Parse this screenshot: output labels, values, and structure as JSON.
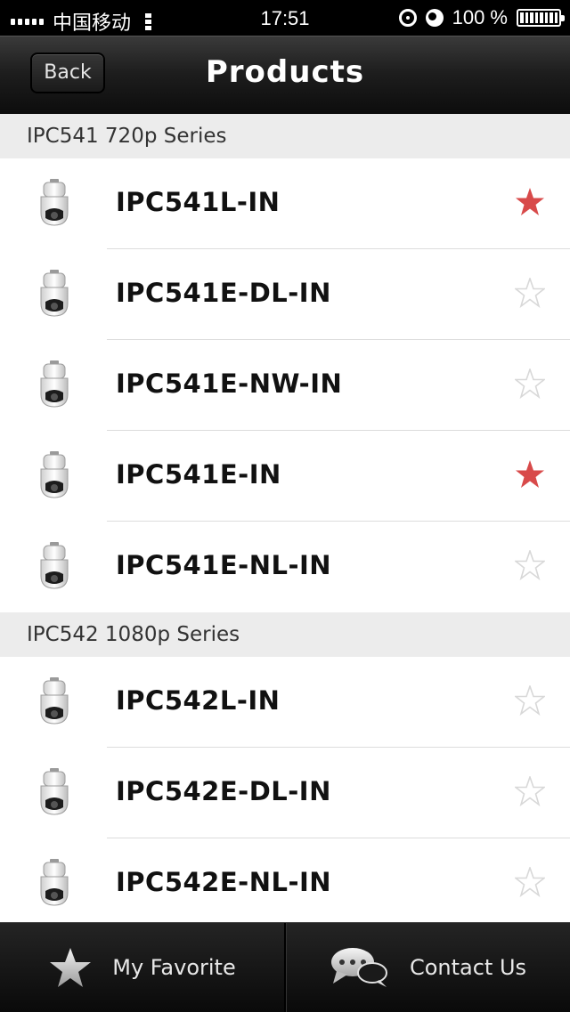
{
  "status_bar": {
    "carrier": "中国移动",
    "time": "17:51",
    "battery": "100 %"
  },
  "nav": {
    "back_label": "Back",
    "title": "Products"
  },
  "sections": [
    {
      "header": "IPC541 720p Series",
      "items": [
        {
          "label": "IPC541L-IN",
          "favorite": true
        },
        {
          "label": "IPC541E-DL-IN",
          "favorite": false
        },
        {
          "label": "IPC541E-NW-IN",
          "favorite": false
        },
        {
          "label": "IPC541E-IN",
          "favorite": true
        },
        {
          "label": "IPC541E-NL-IN",
          "favorite": false
        }
      ]
    },
    {
      "header": "IPC542 1080p Series",
      "items": [
        {
          "label": "IPC542L-IN",
          "favorite": false
        },
        {
          "label": "IPC542E-DL-IN",
          "favorite": false
        },
        {
          "label": "IPC542E-NL-IN",
          "favorite": false
        }
      ]
    }
  ],
  "tabbar": {
    "favorite_label": "My Favorite",
    "contact_label": "Contact Us"
  },
  "icons": {
    "product": "camera-icon",
    "favorite_on": "star-filled-icon",
    "favorite_off": "star-outline-icon",
    "tab_favorite": "star-icon",
    "tab_contact": "chat-bubbles-icon"
  },
  "colors": {
    "star_active": "#d84a4a",
    "star_inactive": "#d8d8d8",
    "section_bg": "#ececec"
  }
}
